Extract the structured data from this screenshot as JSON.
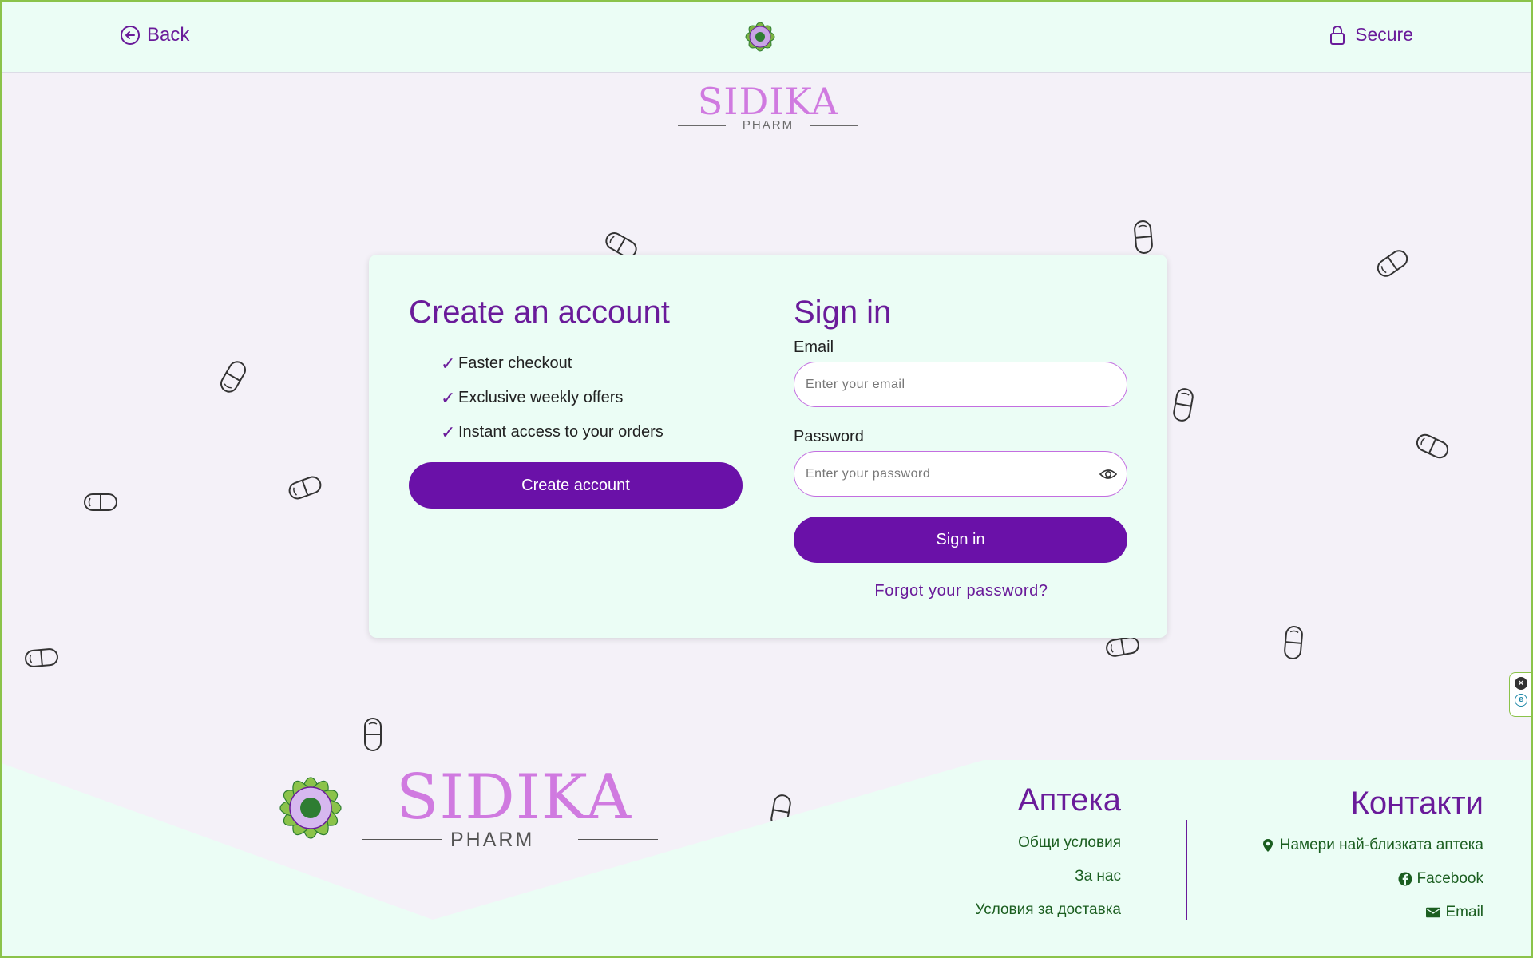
{
  "header": {
    "back_label": "Back",
    "secure_label": "Secure",
    "icons": [
      "arrow-left-circle-icon",
      "lock-icon"
    ]
  },
  "brand": {
    "name": "SIDIKA",
    "sub": "PHARM"
  },
  "create_account": {
    "title": "Create an account",
    "benefits": [
      "Faster checkout",
      "Exclusive weekly offers",
      "Instant access to your orders"
    ],
    "check_glyph": "✓",
    "button_label": "Create account"
  },
  "sign_in": {
    "title": "Sign in",
    "email_label": "Email",
    "email_placeholder": "Enter your email",
    "password_label": "Password",
    "password_placeholder": "Enter your password",
    "button_label": "Sign in",
    "forgot_label": "Forgot your password?"
  },
  "footer": {
    "pharmacy": {
      "title": "Аптека",
      "links": [
        "Общи условия",
        "За нас",
        "Условия за доставка"
      ]
    },
    "contacts": {
      "title": "Контакти",
      "links": [
        {
          "label": "Намери най-близката аптека",
          "icon": "map-marker-icon"
        },
        {
          "label": "Facebook",
          "icon": "facebook-icon"
        },
        {
          "label": "Email",
          "icon": "envelope-icon"
        }
      ]
    }
  },
  "colors": {
    "accent": "#6a1b9a",
    "button": "#6a11a8",
    "panel": "#ebfdf5",
    "background": "#f4f1f8",
    "link_green": "#1b5e20",
    "brand_pink": "#d07ae0"
  }
}
